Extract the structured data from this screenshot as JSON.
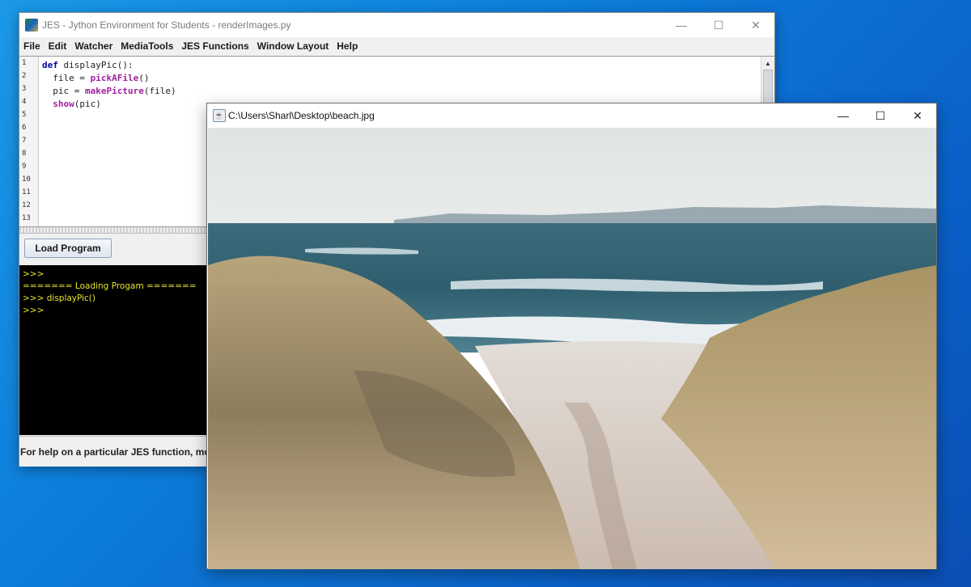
{
  "jes": {
    "title": "JES - Jython Environment for Students - renderImages.py",
    "controls": {
      "minimize": "—",
      "maximize": "☐",
      "close": "✕"
    },
    "menu": [
      "File",
      "Edit",
      "Watcher",
      "MediaTools",
      "JES Functions",
      "Window Layout",
      "Help"
    ],
    "line_numbers": [
      "1",
      "2",
      "3",
      "4",
      "5",
      "6",
      "7",
      "8",
      "9",
      "10",
      "11",
      "12",
      "13"
    ],
    "code": {
      "l1_kw": "def",
      "l1_rest": " displayPic():",
      "l2_pre": "  file = ",
      "l2_fn": "pickAFile",
      "l2_post": "()",
      "l3_pre": "  pic = ",
      "l3_fn": "makePicture",
      "l3_post": "(file)",
      "l4_pre": "  ",
      "l4_fn": "show",
      "l4_post": "(pic)"
    },
    "load_button": "Load Program",
    "console": [
      ">>>",
      "======= Loading Progam =======",
      ">>> displayPic()",
      ">>>"
    ],
    "status": "For help on a particular JES function, move"
  },
  "viewer": {
    "title": "C:\\Users\\Sharl\\Desktop\\beach.jpg",
    "controls": {
      "minimize": "—",
      "maximize": "☐",
      "close": "✕"
    },
    "image": "beach-photo"
  },
  "colors": {
    "desktop": "#0d7fdb",
    "console_bg": "#000000",
    "console_text": "#e8e430",
    "keyword": "#0000a0",
    "function": "#a0209f"
  }
}
